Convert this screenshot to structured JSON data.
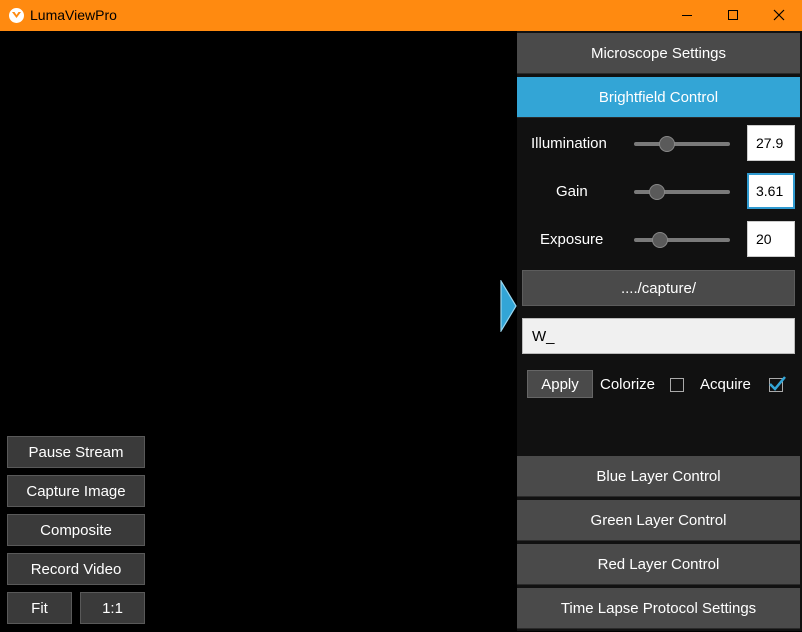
{
  "window": {
    "title": "LumaViewPro"
  },
  "left_controls": {
    "pause_stream": "Pause Stream",
    "capture_image": "Capture Image",
    "composite": "Composite",
    "record_video": "Record Video",
    "fit": "Fit",
    "one_to_one": "1:1"
  },
  "panel": {
    "microscope_settings": "Microscope Settings",
    "brightfield": {
      "title": "Brightfield Control",
      "illumination": {
        "label": "Illumination",
        "value": "27.9",
        "level": 0.31
      },
      "gain": {
        "label": "Gain",
        "value": "3.61",
        "level": 0.19
      },
      "exposure": {
        "label": "Exposure",
        "value": "20",
        "level": 0.23
      },
      "path_button": "..../capture/",
      "filename": "W_",
      "apply": "Apply",
      "colorize_label": "Colorize",
      "colorize_checked": false,
      "acquire_label": "Acquire",
      "acquire_checked": true
    },
    "blue_layer": "Blue Layer Control",
    "green_layer": "Green Layer Control",
    "red_layer": "Red Layer Control",
    "time_lapse": "Time Lapse Protocol Settings"
  },
  "colors": {
    "titlebar": "#ff8a10",
    "accent": "#33a5d6"
  },
  "icons": {
    "app": "luma-logo-icon",
    "toggle": "triangle-right-icon",
    "check": "checkmark-icon"
  }
}
